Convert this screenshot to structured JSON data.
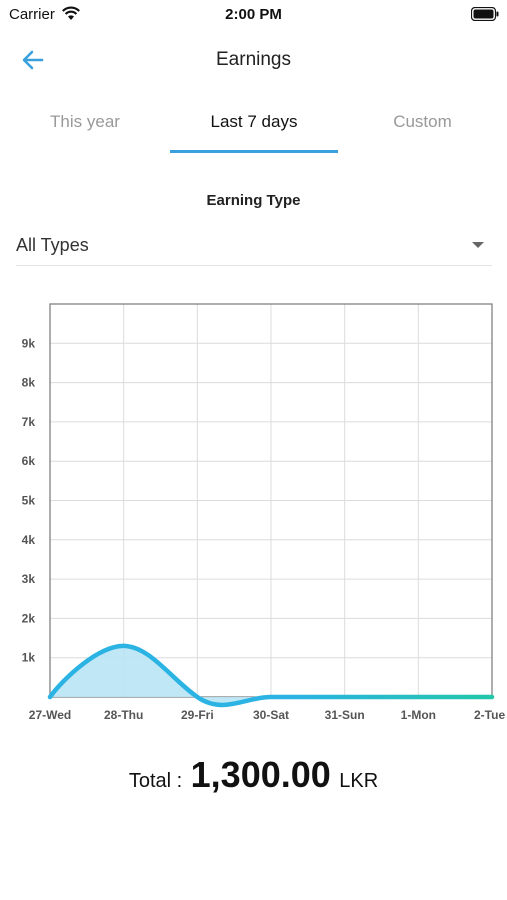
{
  "status": {
    "carrier": "Carrier",
    "time": "2:00 PM"
  },
  "header": {
    "title": "Earnings"
  },
  "tabs": [
    {
      "label": "This year",
      "active": false
    },
    {
      "label": "Last 7 days",
      "active": true
    },
    {
      "label": "Custom",
      "active": false
    }
  ],
  "filter": {
    "label": "Earning Type",
    "selected": "All Types"
  },
  "colors": {
    "accent": "#3aa0dd",
    "line": "#2bb3e3",
    "fill": "#b9e4f5",
    "line_end": "#22c6a8"
  },
  "chart_data": {
    "type": "area",
    "categories": [
      "27-Wed",
      "28-Thu",
      "29-Fri",
      "30-Sat",
      "31-Sun",
      "1-Mon",
      "2-Tue"
    ],
    "values": [
      0,
      1300,
      0,
      0,
      0,
      0,
      0
    ],
    "y_ticks": [
      "1k",
      "2k",
      "3k",
      "4k",
      "5k",
      "6k",
      "7k",
      "8k",
      "9k"
    ],
    "ylim": [
      0,
      10000
    ],
    "grid": true
  },
  "total": {
    "label": "Total :",
    "value": "1,300.00",
    "currency": "LKR"
  }
}
